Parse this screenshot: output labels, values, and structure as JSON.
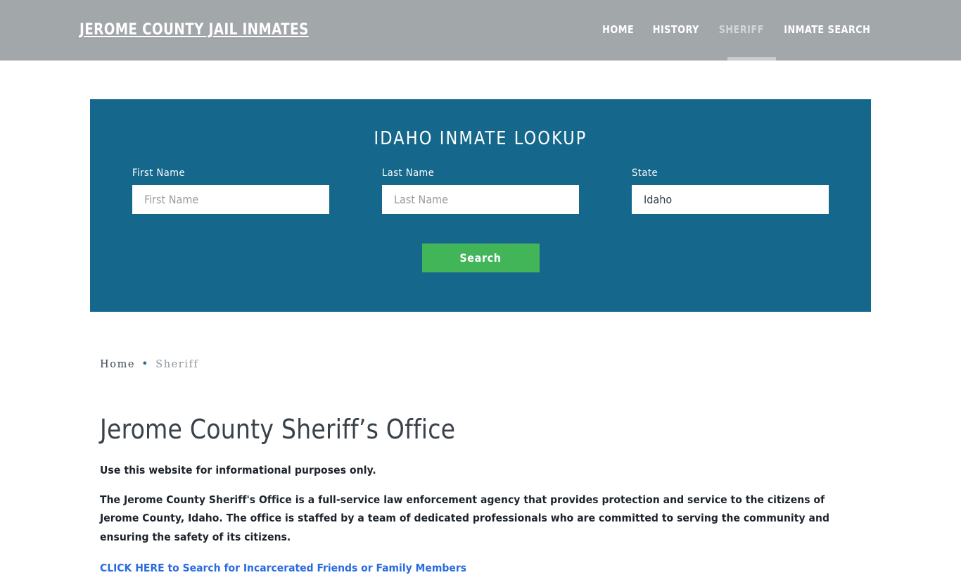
{
  "header": {
    "brand": "Jerome County Jail Inmates",
    "nav": [
      {
        "label": "Home",
        "active": false
      },
      {
        "label": "History",
        "active": false
      },
      {
        "label": "Sheriff",
        "active": true
      },
      {
        "label": "Inmate Search",
        "active": false
      }
    ],
    "background_color": "#a2a7aa",
    "active_bar_color": "#c8cccf"
  },
  "lookup": {
    "title": "Idaho Inmate Lookup",
    "panel_color": "#15688c",
    "fields": {
      "first_name": {
        "label": "First Name",
        "placeholder": "First Name",
        "value": ""
      },
      "last_name": {
        "label": "Last Name",
        "placeholder": "Last Name",
        "value": ""
      },
      "state": {
        "label": "State",
        "selected": "Idaho",
        "options": [
          "Idaho"
        ]
      }
    },
    "search_button": {
      "label": "Search",
      "color": "#41b558"
    }
  },
  "breadcrumb": {
    "home": "Home",
    "separator": "•",
    "current": "Sheriff"
  },
  "main": {
    "title": "Jerome County Sheriff’s Office",
    "lead": "Use this website for informational purposes only.",
    "paragraph": "The Jerome County Sheriff's Office is a full-service law enforcement agency that provides protection and service to the citizens of Jerome County, Idaho. The office is staffed by a team of dedicated professionals who are committed to serving the community and ensuring the safety of its citizens.",
    "cta_link": "CLICK HERE to Search for Incarcerated Friends or Family Members",
    "link_color": "#2a6be0"
  }
}
